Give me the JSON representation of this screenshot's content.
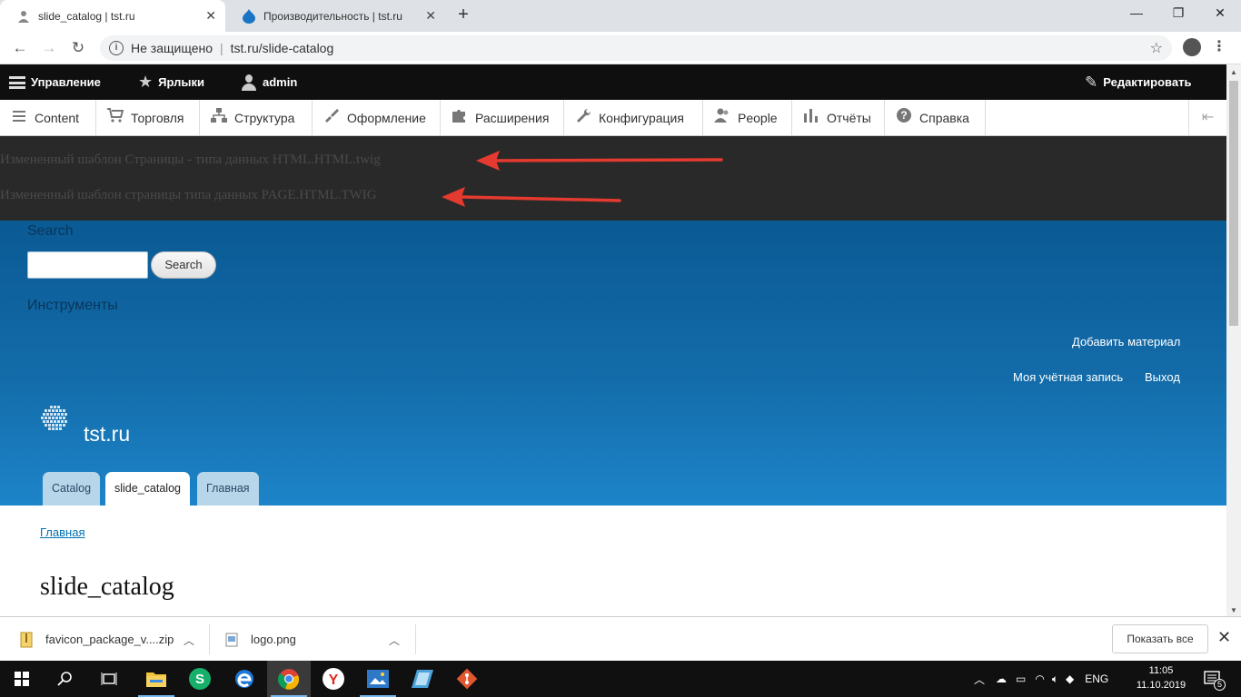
{
  "browser": {
    "tabs": [
      {
        "title": "slide_catalog | tst.ru",
        "active": true
      },
      {
        "title": "Производительность | tst.ru",
        "active": false
      }
    ],
    "security_label": "Не защищено",
    "url": "tst.ru/slide-catalog"
  },
  "admin_toolbar": {
    "manage": "Управление",
    "shortcuts": "Ярлыки",
    "user": "admin",
    "edit": "Редактировать"
  },
  "admin_tray": {
    "items": [
      {
        "label": "Content",
        "icon": "content-icon"
      },
      {
        "label": "Торговля",
        "icon": "cart-icon"
      },
      {
        "label": "Структура",
        "icon": "structure-icon"
      },
      {
        "label": "Оформление",
        "icon": "paintbrush-icon"
      },
      {
        "label": "Расширения",
        "icon": "puzzle-icon"
      },
      {
        "label": "Конфигурация",
        "icon": "wrench-icon"
      },
      {
        "label": "People",
        "icon": "people-icon"
      },
      {
        "label": "Отчёты",
        "icon": "reports-icon"
      },
      {
        "label": "Справка",
        "icon": "help-icon"
      }
    ]
  },
  "template_messages": [
    "Измененный шаблон Страницы - типа данных HTML.HTML.twig",
    "Измененный шаблон страницы типа данных PAGE.HTML.TWIG"
  ],
  "annotation_color": "#e53a2f",
  "search": {
    "label": "Search",
    "button": "Search",
    "value": ""
  },
  "tools_label": "Инструменты",
  "header_links": {
    "add_content": "Добавить материал",
    "my_account": "Моя учётная запись",
    "logout": "Выход"
  },
  "site_name": "tst.ru",
  "primary_tabs": [
    {
      "label": "Catalog",
      "active": false
    },
    {
      "label": "slide_catalog",
      "active": true
    },
    {
      "label": "Главная",
      "active": false
    }
  ],
  "breadcrumb": "Главная",
  "page_title": "slide_catalog",
  "downloads": [
    {
      "name": "favicon_package_v....zip"
    },
    {
      "name": "logo.png"
    }
  ],
  "show_all": "Показать все",
  "taskbar": {
    "language": "ENG",
    "time": "11:05",
    "date": "11.10.2019",
    "notifications": "5"
  },
  "colors": {
    "admin_bar": "#0f0f0f",
    "hero_top": "#0a5a94",
    "hero_bottom": "#1d84c9",
    "link": "#0071b3"
  }
}
